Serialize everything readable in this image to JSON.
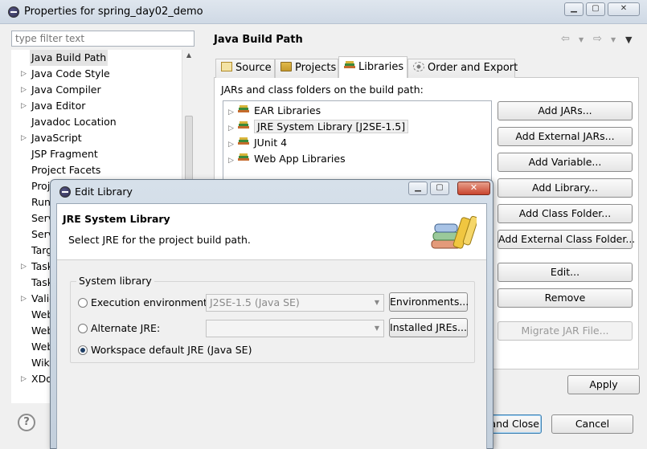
{
  "window": {
    "title": "Properties for spring_day02_demo"
  },
  "filter": {
    "placeholder": "type filter text"
  },
  "tree": {
    "items": [
      {
        "label": "Java Build Path",
        "expandable": false,
        "selected": true
      },
      {
        "label": "Java Code Style",
        "expandable": true
      },
      {
        "label": "Java Compiler",
        "expandable": true
      },
      {
        "label": "Java Editor",
        "expandable": true
      },
      {
        "label": "Javadoc Location",
        "expandable": false
      },
      {
        "label": "JavaScript",
        "expandable": true
      },
      {
        "label": "JSP Fragment",
        "expandable": false
      },
      {
        "label": "Project Facets",
        "expandable": false
      },
      {
        "label": "Proje",
        "expandable": false
      },
      {
        "label": "Run/",
        "expandable": false
      },
      {
        "label": "Serv",
        "expandable": false
      },
      {
        "label": "Serv",
        "expandable": false
      },
      {
        "label": "Targ",
        "expandable": false
      },
      {
        "label": "Task",
        "expandable": true
      },
      {
        "label": "Task",
        "expandable": false
      },
      {
        "label": "Valid",
        "expandable": true
      },
      {
        "label": "Web",
        "expandable": false
      },
      {
        "label": "Web",
        "expandable": false
      },
      {
        "label": "Web",
        "expandable": false
      },
      {
        "label": "Wiki",
        "expandable": false
      },
      {
        "label": "XDo",
        "expandable": true
      }
    ]
  },
  "page": {
    "title": "Java Build Path",
    "tabs": [
      {
        "label": "Source",
        "icon": "source-folder-icon"
      },
      {
        "label": "Projects",
        "icon": "projects-icon"
      },
      {
        "label": "Libraries",
        "icon": "libraries-icon",
        "active": true
      },
      {
        "label": "Order and Export",
        "icon": "order-export-icon"
      }
    ],
    "libraries_label": "JARs and class folders on the build path:",
    "libraries": [
      {
        "label": "EAR Libraries"
      },
      {
        "label": "JRE System Library [J2SE-1.5]",
        "selected": true
      },
      {
        "label": "JUnit 4"
      },
      {
        "label": "Web App Libraries"
      }
    ],
    "buttons": {
      "add_jars": "Add JARs...",
      "add_external_jars": "Add External JARs...",
      "add_variable": "Add Variable...",
      "add_library": "Add Library...",
      "add_class_folder": "Add Class Folder...",
      "add_external_class_folder": "Add External Class Folder...",
      "edit": "Edit...",
      "remove": "Remove",
      "migrate_jar": "Migrate JAR File..."
    },
    "apply": "Apply",
    "ok_partial": "and Close",
    "cancel": "Cancel"
  },
  "dialog": {
    "title": "Edit Library",
    "banner_title": "JRE System Library",
    "banner_subtitle": "Select JRE for the project build path.",
    "group_label": "System library",
    "options": [
      {
        "label": "Execution environment:",
        "checked": false,
        "combo": "J2SE-1.5 (Java SE)",
        "button": "Environments..."
      },
      {
        "label": "Alternate JRE:",
        "checked": false,
        "combo": "",
        "button": "Installed JREs..."
      },
      {
        "label": "Workspace default JRE (Java SE)",
        "checked": true
      }
    ]
  },
  "colors": {
    "accent": "#3c7fb1",
    "close_button": "#c8452e"
  }
}
